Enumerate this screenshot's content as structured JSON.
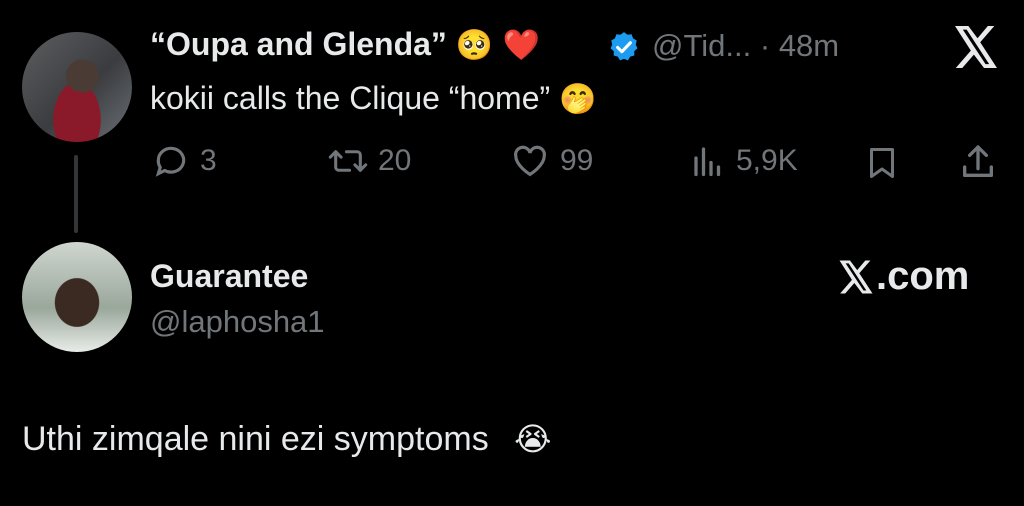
{
  "quoted_tweet": {
    "display_name": "“Oupa and Glenda”",
    "emoji_after_name": "🥺 ❤️",
    "handle": "@Tid...",
    "separator": "·",
    "time": "48m",
    "text": "kokii calls the Clique “home”",
    "text_emoji": "🤭",
    "actions": {
      "replies": "3",
      "reposts": "20",
      "likes": "99",
      "views": "5,9K"
    }
  },
  "reply": {
    "display_name": "Guarantee",
    "handle": "@laphosha1",
    "watermark": "X.com",
    "text": "Uthi zimqale nini ezi symptoms",
    "text_emoji": "😭"
  },
  "icons": {
    "close": "x-logo-icon",
    "verified": "verified-badge-icon",
    "reply": "reply-icon",
    "repost": "repost-icon",
    "like": "like-icon",
    "views": "views-icon",
    "bookmark": "bookmark-icon",
    "share": "share-icon"
  },
  "colors": {
    "background": "#000000",
    "text": "#e7e9ea",
    "muted": "#71767b",
    "verified": "#1d9bf0"
  }
}
